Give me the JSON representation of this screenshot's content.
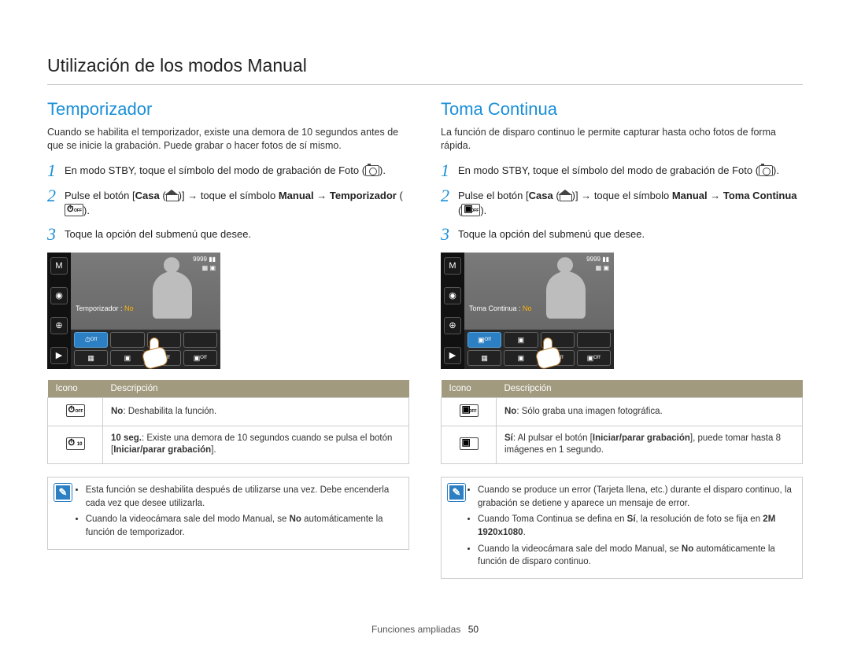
{
  "page_title": "Utilización de los modos Manual",
  "footer_label": "Funciones ampliadas",
  "page_number": "50",
  "left": {
    "heading": "Temporizador",
    "intro": "Cuando se habilita el temporizador, existe una demora de 10 segundos antes de que se inicie la grabación. Puede grabar o hacer fotos de sí mismo.",
    "steps": [
      {
        "num": "1",
        "text_a": "En modo STBY, toque el símbolo del modo de grabación de Foto (",
        "text_b": ")."
      },
      {
        "num": "2",
        "text_a": "Pulse el botón [",
        "bold1": "Casa",
        "text_b": " (",
        "text_c": ")] → toque el símbolo ",
        "bold2": "Manual",
        "text_d": " → ",
        "bold3": "Temporizador",
        "text_e": " (",
        "text_f": ")."
      },
      {
        "num": "3",
        "text_a": "Toque la opción del submenú que desee."
      }
    ],
    "device": {
      "counter": "9999",
      "msg_label": "Temporizador : ",
      "msg_value": "No"
    },
    "table": {
      "h1": "Icono",
      "h2": "Descripción",
      "rows": [
        {
          "desc_bold": "No",
          "desc": ": Deshabilita la función."
        },
        {
          "desc_bold": "10 seg.",
          "desc": ": Existe una demora de 10 segundos cuando se pulsa el botón [",
          "desc_bold2": "Iniciar/parar grabación",
          "desc_tail": "]."
        }
      ]
    },
    "notes": [
      "Esta función se deshabilita después de utilizarse una vez. Debe encenderla cada vez que desee utilizarla.",
      {
        "pre": "Cuando la videocámara sale del modo Manual, se ",
        "bold": "No",
        "post": " automáticamente la función de temporizador."
      }
    ]
  },
  "right": {
    "heading": "Toma Continua",
    "intro": "La función de disparo continuo le permite capturar hasta ocho fotos de forma rápida.",
    "steps": [
      {
        "num": "1",
        "text_a": "En modo STBY, toque el símbolo del modo de grabación de Foto (",
        "text_b": ")."
      },
      {
        "num": "2",
        "text_a": "Pulse el botón [",
        "bold1": "Casa",
        "text_b": " (",
        "text_c": ")] → toque el símbolo ",
        "bold2": "Manual",
        "text_d": " → ",
        "bold3": "Toma Continua",
        "text_e": " (",
        "text_f": ")."
      },
      {
        "num": "3",
        "text_a": "Toque la opción del submenú que desee."
      }
    ],
    "device": {
      "counter": "9999",
      "msg_label": "Toma Continua : ",
      "msg_value": "No"
    },
    "table": {
      "h1": "Icono",
      "h2": "Descripción",
      "rows": [
        {
          "desc_bold": "No",
          "desc": ": Sólo graba una imagen fotográfica."
        },
        {
          "desc_bold": "Sí",
          "desc": ": Al pulsar el botón [",
          "desc_bold2": "Iniciar/parar grabación",
          "desc_tail": "], puede tomar hasta 8 imágenes en 1 segundo."
        }
      ]
    },
    "notes": [
      "Cuando se produce un error (Tarjeta llena, etc.) durante el disparo continuo, la grabación se detiene y aparece un mensaje de error.",
      {
        "pre": "Cuando Toma Continua se defina en ",
        "bold": "Sí",
        "mid": ", la resolución de foto se fija en ",
        "bold2": "2M 1920x1080",
        "post": "."
      },
      {
        "pre": "Cuando la videocámara sale del modo Manual, se ",
        "bold": "No",
        "post": " automáticamente la función de disparo continuo."
      }
    ]
  }
}
